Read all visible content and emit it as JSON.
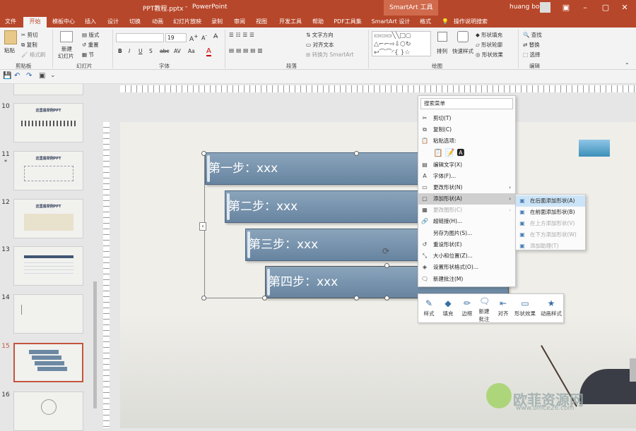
{
  "titlebar": {
    "filename": "PPT教程.pptx",
    "separator": "-",
    "app": "PowerPoint",
    "context_tool": "SmartArt 工具",
    "user": "huang bo"
  },
  "tabs": {
    "file": "文件",
    "home": "开始",
    "template": "模板中心",
    "insert": "插入",
    "design": "设计",
    "transition": "切换",
    "animation": "动画",
    "slideshow": "幻灯片放映",
    "record": "录制",
    "review": "审阅",
    "view": "视图",
    "dev": "开发工具",
    "help": "帮助",
    "pdf": "PDF工具集",
    "smartart_design": "SmartArt 设计",
    "format": "格式",
    "tellme": "操作说明搜索"
  },
  "ribbon": {
    "clipboard": {
      "paste": "粘贴",
      "cut": "剪切",
      "copy": "复制",
      "format_painter": "格式刷",
      "group": "剪贴板"
    },
    "slides": {
      "new_slide_1": "新建",
      "new_slide_2": "幻灯片",
      "layout": "版式",
      "reset": "重置",
      "section": "节",
      "group": "幻灯片"
    },
    "font": {
      "size": "19",
      "group": "字体"
    },
    "paragraph": {
      "text_direction": "文字方向",
      "align_text": "对齐文本",
      "convert_smartart": "转换为 SmartArt",
      "group": "段落"
    },
    "drawing": {
      "arrange": "排列",
      "quick_styles": "快速样式",
      "shape_fill": "形状填充",
      "shape_outline": "形状轮廓",
      "shape_effects": "形状效果",
      "group": "绘图"
    },
    "editing": {
      "find": "查找",
      "replace": "替换",
      "select": "选择",
      "group": "编辑"
    }
  },
  "thumbnails": [
    {
      "num": "10",
      "title": "这里是举例PPT"
    },
    {
      "num": "11",
      "title": "这里是举例PPT"
    },
    {
      "num": "12",
      "title": "这里是举例PPT"
    },
    {
      "num": "13",
      "title": ""
    },
    {
      "num": "14",
      "title": ""
    },
    {
      "num": "15",
      "title": ""
    },
    {
      "num": "16",
      "title": ""
    }
  ],
  "thumb11_marker": "*",
  "slide": {
    "steps": [
      "第一步：xxx",
      "第二步：xxx",
      "第三步：xxx",
      "第四步：xxx"
    ]
  },
  "context_menu": {
    "search": "搜索菜单",
    "items": [
      {
        "label": "剪切(T)",
        "icon": "✂",
        "disabled": false,
        "sub": false
      },
      {
        "label": "复制(C)",
        "icon": "⧉",
        "disabled": false,
        "sub": false
      },
      {
        "label": "粘贴选项:",
        "icon": "📋",
        "disabled": false,
        "sub": false
      },
      {
        "label": "编辑文字(X)",
        "icon": "▤",
        "disabled": false,
        "sub": false
      },
      {
        "label": "字体(F)...",
        "icon": "A",
        "disabled": false,
        "sub": false
      },
      {
        "label": "更改形状(N)",
        "icon": "▭",
        "disabled": false,
        "sub": true
      },
      {
        "label": "添加形状(A)",
        "icon": "▢",
        "disabled": false,
        "sub": true,
        "highlight": true
      },
      {
        "label": "更改图形(C)",
        "icon": "▦",
        "disabled": true,
        "sub": true
      },
      {
        "label": "超链接(H)...",
        "icon": "🔗",
        "disabled": false,
        "sub": false
      },
      {
        "label": "另存为图片(S)...",
        "icon": "",
        "disabled": false,
        "sub": false
      },
      {
        "label": "重设形状(E)",
        "icon": "↺",
        "disabled": false,
        "sub": false
      },
      {
        "label": "大小和位置(Z)...",
        "icon": "⤡",
        "disabled": false,
        "sub": false
      },
      {
        "label": "设置形状格式(O)...",
        "icon": "◈",
        "disabled": false,
        "sub": false
      },
      {
        "label": "新建批注(M)",
        "icon": "🗨",
        "disabled": false,
        "sub": false
      }
    ]
  },
  "submenu": {
    "items": [
      {
        "label": "在后面添加形状(A)",
        "disabled": false,
        "highlight": true
      },
      {
        "label": "在前面添加形状(B)",
        "disabled": false
      },
      {
        "label": "在上方添加形状(V)",
        "disabled": true
      },
      {
        "label": "在下方添加形状(W)",
        "disabled": true
      },
      {
        "label": "添加助理(T)",
        "disabled": true
      }
    ]
  },
  "mini_toolbar": {
    "style": "样式",
    "fill": "填充",
    "border": "边框",
    "new_comment_1": "新建",
    "new_comment_2": "批注",
    "align": "对齐",
    "shape_effects": "形状效果",
    "anim_style": "动画样式"
  },
  "watermark": {
    "text": "欧菲资源网",
    "url": "www.office26.com"
  },
  "colors": {
    "accent": "#b7472a",
    "step_fill": "#7893ad"
  }
}
